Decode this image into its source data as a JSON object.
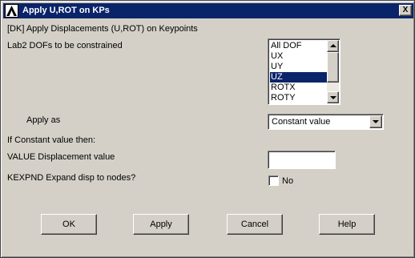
{
  "window": {
    "title": "Apply U,ROT on KPs",
    "close_label": "X",
    "accent_color": "#0a246a",
    "background_color": "#d4d0c8"
  },
  "header": {
    "command": "[DK]  Apply Displacements (U,ROT) on Keypoints"
  },
  "lab2": {
    "label": "Lab2    DOFs to be constrained",
    "items": [
      {
        "label": "All DOF"
      },
      {
        "label": "UX"
      },
      {
        "label": "UY"
      },
      {
        "label": "UZ"
      },
      {
        "label": "ROTX"
      },
      {
        "label": "ROTY"
      }
    ],
    "selected": "UZ"
  },
  "apply_as": {
    "label": "Apply as",
    "value": "Constant value"
  },
  "constant_section": {
    "label": "If Constant value then:"
  },
  "value_field": {
    "label": "VALUE  Displacement value",
    "value": ""
  },
  "kexpnd": {
    "label": "KEXPND  Expand disp to nodes?",
    "checkbox_label": "No",
    "checked": false
  },
  "buttons": {
    "ok": "OK",
    "apply": "Apply",
    "cancel": "Cancel",
    "help": "Help"
  }
}
